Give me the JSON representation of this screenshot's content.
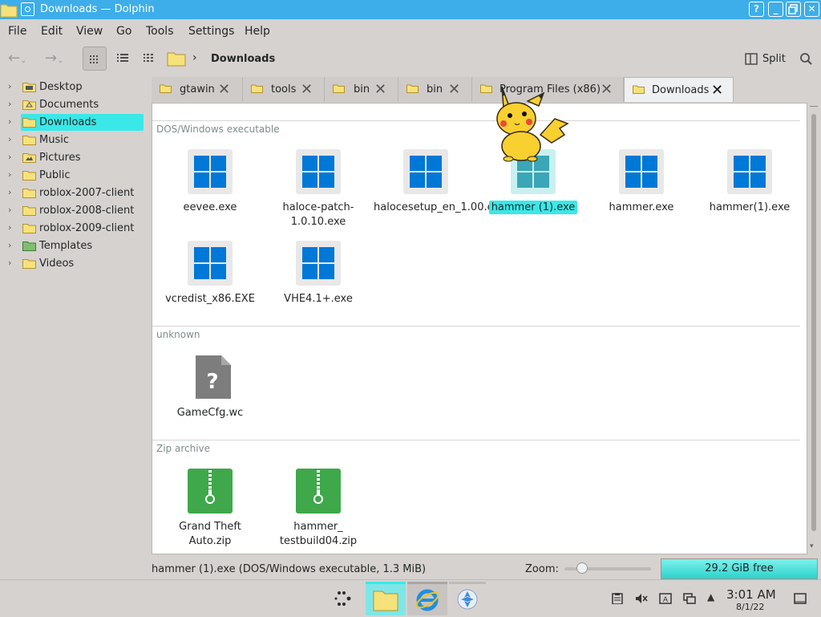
{
  "window": {
    "title": "Downloads — Dolphin"
  },
  "menu": [
    "File",
    "Edit",
    "View",
    "Go",
    "Tools",
    "Settings",
    "Help"
  ],
  "toolbar": {
    "location": "Downloads",
    "split_label": "Split"
  },
  "sidebar": {
    "items": [
      {
        "label": "Desktop",
        "icon": "desktop-folder-icon"
      },
      {
        "label": "Documents",
        "icon": "documents-folder-icon"
      },
      {
        "label": "Downloads",
        "icon": "downloads-folder-icon",
        "selected": true
      },
      {
        "label": "Music",
        "icon": "music-folder-icon"
      },
      {
        "label": "Pictures",
        "icon": "pictures-folder-icon"
      },
      {
        "label": "Public",
        "icon": "public-folder-icon"
      },
      {
        "label": "roblox-2007-client",
        "icon": "folder-icon"
      },
      {
        "label": "roblox-2008-client",
        "icon": "folder-icon"
      },
      {
        "label": "roblox-2009-client",
        "icon": "folder-icon"
      },
      {
        "label": "Templates",
        "icon": "templates-folder-icon"
      },
      {
        "label": "Videos",
        "icon": "videos-folder-icon"
      }
    ]
  },
  "tabs": [
    {
      "label": "gtawin"
    },
    {
      "label": "tools"
    },
    {
      "label": "bin"
    },
    {
      "label": "bin"
    },
    {
      "label": "Program Files (x86)"
    },
    {
      "label": "Downloads",
      "active": true
    }
  ],
  "groups": [
    {
      "header": "DOS/Windows executable",
      "files": [
        {
          "name": "eevee.exe",
          "icon": "windows-exe-icon"
        },
        {
          "name": "haloce-patch-1.0.10.exe",
          "icon": "windows-exe-icon"
        },
        {
          "name": "halocesetup_en_1.00.exe",
          "icon": "windows-exe-icon"
        },
        {
          "name": "hammer (1).exe",
          "icon": "windows-exe-icon",
          "selected": true
        },
        {
          "name": "hammer.exe",
          "icon": "windows-exe-icon"
        },
        {
          "name": "hammer(1).exe",
          "icon": "windows-exe-icon"
        },
        {
          "name": "vcredist_x86.EXE",
          "icon": "windows-exe-icon"
        },
        {
          "name": "VHE4.1+.exe",
          "icon": "windows-exe-icon"
        }
      ]
    },
    {
      "header": "unknown",
      "files": [
        {
          "name": "GameCfg.wc",
          "icon": "unknown-file-icon"
        }
      ]
    },
    {
      "header": "Zip archive",
      "files": [
        {
          "name": "Grand Theft Auto.zip",
          "icon": "zip-archive-icon"
        },
        {
          "name": "hammer_ testbuild04.zip",
          "icon": "zip-archive-icon"
        }
      ]
    }
  ],
  "status": {
    "selection": "hammer (1).exe (DOS/Windows executable, 1.3 MiB)",
    "zoom_label": "Zoom:",
    "zoom_level": 0.2,
    "free_space": "29.2 GiB free",
    "used_fraction": 1.0
  },
  "taskbar": {
    "time": "3:01 AM",
    "date": "8/1/22"
  },
  "colors": {
    "accent": "#3daee9",
    "selection": "#3ae8e8",
    "windows_blue": "#0078d7",
    "zip_green": "#3ea84a"
  }
}
